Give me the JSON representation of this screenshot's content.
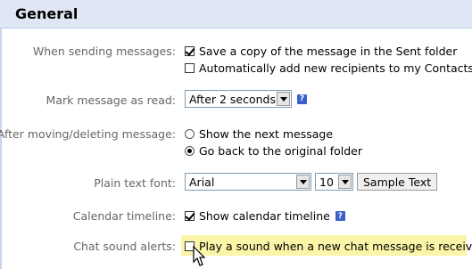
{
  "header": {
    "title": "General"
  },
  "sending": {
    "label": "When sending messages:",
    "save_copy": "Save a copy of the message in the Sent folder",
    "auto_add": "Automatically add new recipients to my Contacts"
  },
  "mark_read": {
    "label": "Mark message as read:",
    "selected": "After 2 seconds"
  },
  "after_move": {
    "label": "After moving/deleting message:",
    "opt_next": "Show the next message",
    "opt_back": "Go back to the original folder"
  },
  "font": {
    "label": "Plain text font:",
    "family": "Arial",
    "size": "10",
    "sample": "Sample Text"
  },
  "calendar": {
    "label": "Calendar timeline:",
    "option": "Show calendar timeline"
  },
  "chat": {
    "label": "Chat sound alerts:",
    "option": "Play a sound when a new chat message is received"
  },
  "icons": {
    "help": "help-icon",
    "cursor": "mouse-pointer-icon"
  }
}
